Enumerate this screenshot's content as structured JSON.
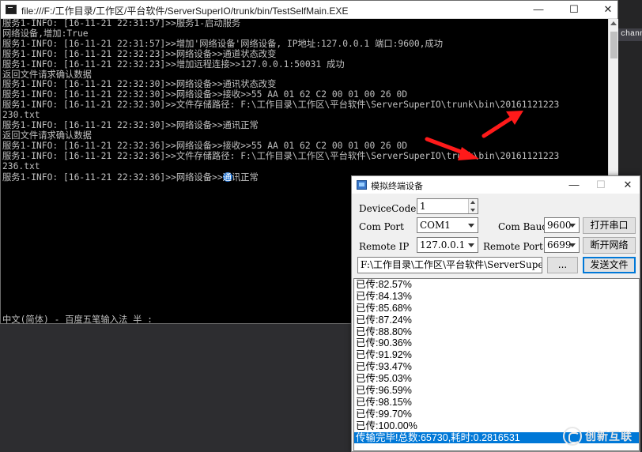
{
  "ide": {
    "tab_label": "channel"
  },
  "console": {
    "title": "file:///F:/工作目录/工作区/平台软件/ServerSuperIO/trunk/bin/TestSelfMain.EXE",
    "controls": {
      "minimize": "—",
      "maximize": "☐",
      "close": "✕"
    },
    "lines": [
      "服务1-INFO: [16-11-21 22:31:57]>>服务1-启动服务",
      "网络设备,增加:True",
      "服务1-INFO: [16-11-21 22:31:57]>>增加'网络设备'网络设备, IP地址:127.0.0.1 端口:9600,成功",
      "服务1-INFO: [16-11-21 22:32:23]>>网络设备>>通道状态改变",
      "服务1-INFO: [16-11-21 22:32:23]>>增加远程连接>>127.0.0.1:50031 成功",
      "返回文件请求确认数据",
      "服务1-INFO: [16-11-21 22:32:30]>>网络设备>>通讯状态改变",
      "服务1-INFO: [16-11-21 22:32:30]>>网络设备>>接收>>55 AA 01 62 C2 00 01 00 26 0D",
      "服务1-INFO: [16-11-21 22:32:30]>>文件存储路径: F:\\工作目录\\工作区\\平台软件\\ServerSuperIO\\trunk\\bin\\20161121223",
      "230.txt",
      "服务1-INFO: [16-11-21 22:32:30]>>网络设备>>通讯正常",
      "返回文件请求确认数据",
      "服务1-INFO: [16-11-21 22:32:36]>>网络设备>>接收>>55 AA 01 62 C2 00 01 00 26 0D",
      "服务1-INFO: [16-11-21 22:32:36]>>文件存储路径: F:\\工作目录\\工作区\\平台软件\\ServerSuperIO\\trunk\\bin\\20161121223",
      "236.txt"
    ],
    "last_line_prefix": "服务1-INFO: [16-11-21 22:32:36]>>网络设备>>",
    "last_line_cursor_char": "通",
    "last_line_suffix": "讯正常",
    "ime_status": "中文(简体) - 百度五笔输入法 半 :"
  },
  "simulator": {
    "title": "模拟终端设备",
    "controls": {
      "minimize": "—",
      "maximize": "☐",
      "close": "✕"
    },
    "labels": {
      "device_code": "DeviceCode",
      "com_port": "Com Port",
      "com_baud": "Com Baud",
      "remote_ip": "Remote IP",
      "remote_port": "Remote Port"
    },
    "fields": {
      "device_code": "1",
      "com_port": "COM1",
      "com_baud": "9600",
      "remote_ip": "127.0.0.1",
      "remote_port": "6699",
      "file_path": "F:\\工作目录\\工作区\\平台软件\\ServerSuperIO"
    },
    "buttons": {
      "open_serial": "打开串口",
      "disconnect_network": "断开网络",
      "browse": "...",
      "send_file": "发送文件"
    },
    "log": [
      "已传:82.57%",
      "已传:84.13%",
      "已传:85.68%",
      "已传:87.24%",
      "已传:88.80%",
      "已传:90.36%",
      "已传:91.92%",
      "已传:93.47%",
      "已传:95.03%",
      "已传:96.59%",
      "已传:98.15%",
      "已传:99.70%",
      "已传:100.00%"
    ],
    "log_selected": "传输完毕!总数:65730,耗时:0.2816531"
  },
  "watermark": {
    "text": "创新互联"
  },
  "colors": {
    "arrow": "#ff1a1a",
    "selection": "#0078d7",
    "console_text": "#c0c0c0"
  }
}
